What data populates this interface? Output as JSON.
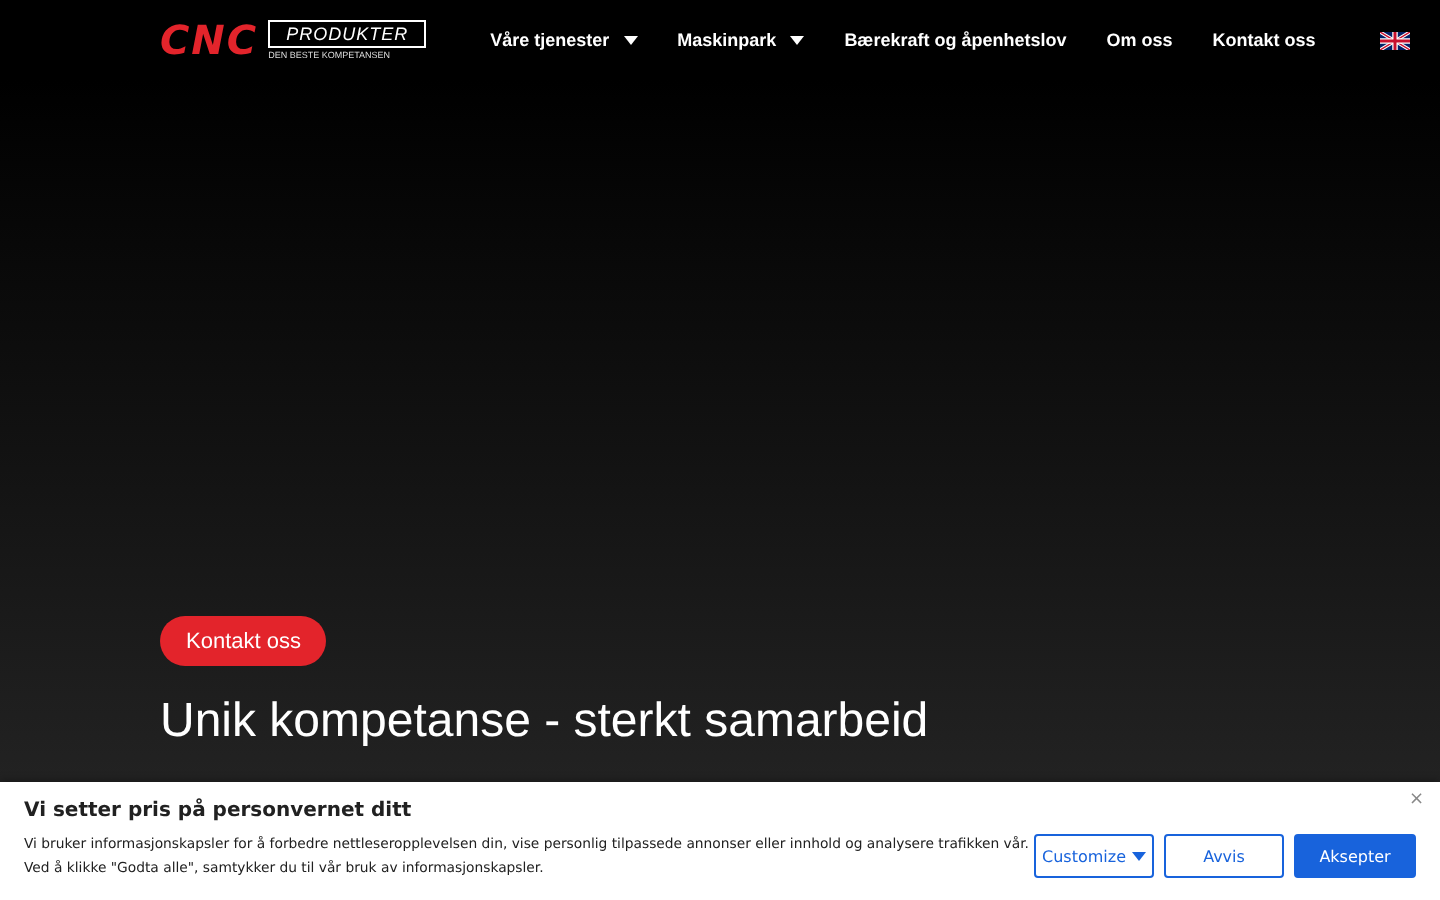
{
  "header": {
    "logo": {
      "mark": "CNC",
      "name": "PRODUKTER",
      "tagline": "DEN BESTE KOMPETANSEN"
    },
    "nav": [
      {
        "label": "Våre tjenester",
        "dropdown": true
      },
      {
        "label": "Maskinpark",
        "dropdown": true
      },
      {
        "label": "Bærekraft og åpenhetslov",
        "dropdown": false
      },
      {
        "label": "Om oss",
        "dropdown": false
      },
      {
        "label": "Kontakt oss",
        "dropdown": false
      }
    ]
  },
  "hero": {
    "button": "Kontakt oss",
    "heading": "Unik kompetanse - sterkt samarbeid"
  },
  "cookie_banner": {
    "title": "Vi setter pris på personvernet ditt",
    "text": "Vi bruker informasjonskapsler for å forbedre nettleseropplevelsen din, vise personlig tilpassede annonser eller innhold og analysere trafikken vår. Ved å klikke \"Godta alle\", samtykker du til vår bruk av informasjonskapsler.",
    "close": "×",
    "buttons": [
      {
        "label": "Customize",
        "kind": "outline",
        "dropdown": true
      },
      {
        "label": "Avvis",
        "kind": "outline",
        "dropdown": false
      },
      {
        "label": "Aksepter",
        "kind": "primary",
        "dropdown": false
      }
    ]
  }
}
